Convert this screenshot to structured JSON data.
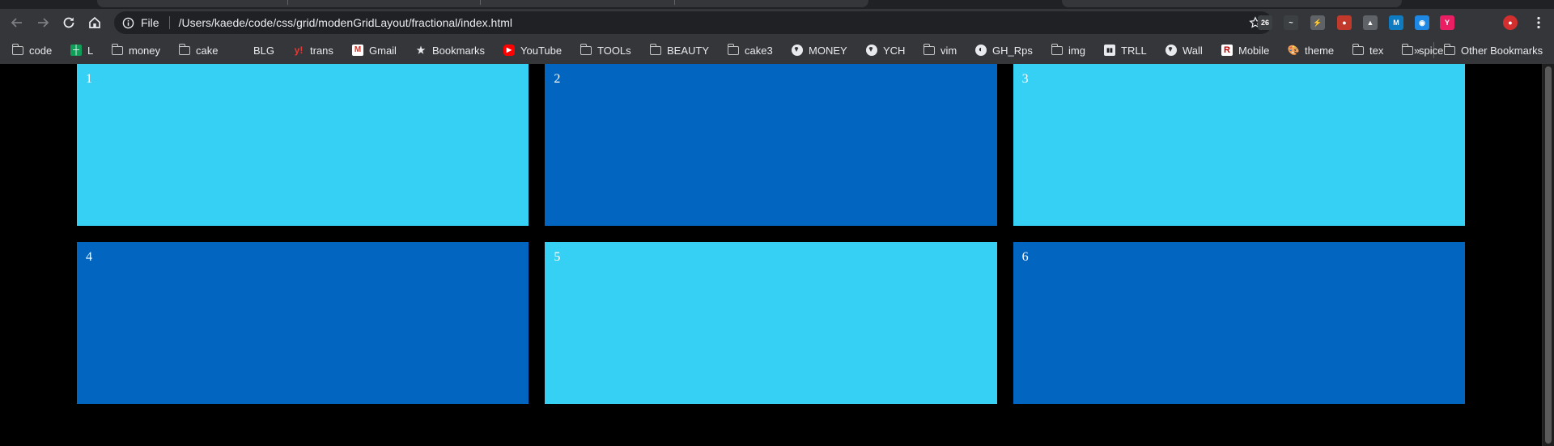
{
  "browser": {
    "address_bar": {
      "scheme_label": "File",
      "url": "/Users/kaede/code/css/grid/modenGridLayout/fractional/index.html"
    },
    "nav_icons": [
      "back-icon",
      "forward-icon",
      "reload-icon",
      "home-icon"
    ],
    "extensions": [
      {
        "name": "extension-1-icon",
        "glyph": "26",
        "color": "#3c4043"
      },
      {
        "name": "extension-2-icon",
        "glyph": "~",
        "color": "#3c4043"
      },
      {
        "name": "extension-3-icon",
        "glyph": "⚡",
        "color": "#5f6368"
      },
      {
        "name": "extension-4-icon",
        "glyph": "●",
        "color": "#c0392b"
      },
      {
        "name": "extension-5-icon",
        "glyph": "▲",
        "color": "#5f6368"
      },
      {
        "name": "extension-6-icon",
        "glyph": "M",
        "color": "#0e7bc1"
      },
      {
        "name": "extension-7-icon",
        "glyph": "◉",
        "color": "#1e88e5"
      },
      {
        "name": "extension-8-icon",
        "glyph": "Y",
        "color": "#e91e63"
      },
      {
        "name": "extension-9-icon",
        "glyph": "",
        "color": "#35363a"
      },
      {
        "name": "profile-avatar",
        "glyph": "●",
        "color": "#d32f2f"
      }
    ]
  },
  "bookmarks": [
    {
      "label": "code",
      "icon": "folder-icon"
    },
    {
      "label": "L",
      "icon": "sheets-icon"
    },
    {
      "label": "money",
      "icon": "folder-icon"
    },
    {
      "label": "cake",
      "icon": "folder-icon"
    },
    {
      "label": "BLG",
      "icon": "blank-page-icon"
    },
    {
      "label": "trans",
      "icon": "yahoo-icon"
    },
    {
      "label": "Gmail",
      "icon": "gmail-icon"
    },
    {
      "label": "Bookmarks",
      "icon": "star-icon"
    },
    {
      "label": "YouTube",
      "icon": "youtube-icon"
    },
    {
      "label": "TOOLs",
      "icon": "folder-icon"
    },
    {
      "label": "BEAUTY",
      "icon": "folder-icon"
    },
    {
      "label": "cake3",
      "icon": "folder-icon"
    },
    {
      "label": "MONEY",
      "icon": "globe-icon"
    },
    {
      "label": "YCH",
      "icon": "globe-icon"
    },
    {
      "label": "vim",
      "icon": "folder-icon"
    },
    {
      "label": "GH_Rps",
      "icon": "github-icon"
    },
    {
      "label": "img",
      "icon": "folder-icon"
    },
    {
      "label": "TRLL",
      "icon": "trello-icon"
    },
    {
      "label": "Wall",
      "icon": "globe-icon"
    },
    {
      "label": "Mobile",
      "icon": "rakuten-icon"
    },
    {
      "label": "theme",
      "icon": "palette-icon"
    },
    {
      "label": "tex",
      "icon": "folder-icon"
    },
    {
      "label": "spice",
      "icon": "folder-icon"
    }
  ],
  "bookmarks_overflow": "»",
  "other_bookmarks": "Other Bookmarks",
  "grid": {
    "colors": {
      "light": "#37d0f5",
      "dark": "#0266c0"
    },
    "items": [
      {
        "label": "1",
        "tone": "light"
      },
      {
        "label": "2",
        "tone": "dark"
      },
      {
        "label": "3",
        "tone": "light"
      },
      {
        "label": "4",
        "tone": "dark"
      },
      {
        "label": "5",
        "tone": "light"
      },
      {
        "label": "6",
        "tone": "dark"
      }
    ]
  }
}
